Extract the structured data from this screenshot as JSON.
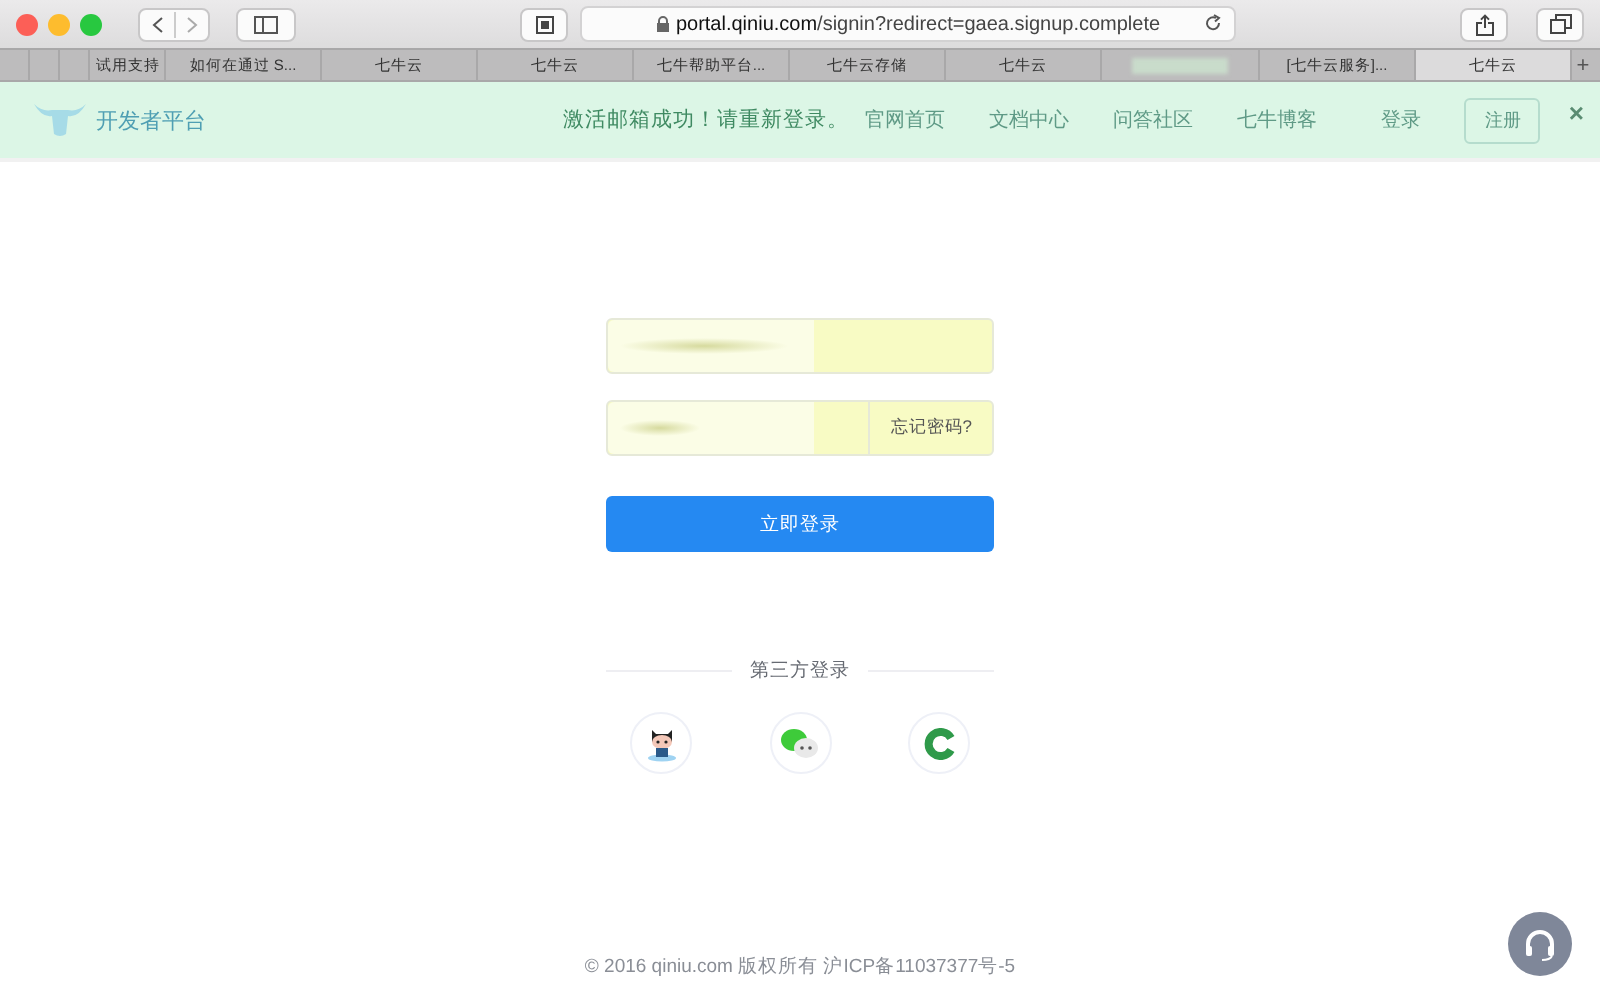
{
  "browser": {
    "url_host": "portal.qiniu.com",
    "url_path": "/signin?redirect=gaea.signup.complete"
  },
  "tabs": [
    {
      "kind": "stub",
      "selected": false
    },
    {
      "kind": "stub",
      "selected": false
    },
    {
      "kind": "stub",
      "selected": false
    },
    {
      "label": "试用支持",
      "kind": "narrow",
      "selected": false
    },
    {
      "label": "如何在通过 S...",
      "kind": "normal",
      "selected": false
    },
    {
      "label": "七牛云",
      "kind": "normal",
      "selected": false
    },
    {
      "label": "七牛云",
      "kind": "normal",
      "selected": false
    },
    {
      "label": "七牛帮助平台...",
      "kind": "normal",
      "selected": false
    },
    {
      "label": "七牛云存储",
      "kind": "normal",
      "selected": false
    },
    {
      "label": "七牛云",
      "kind": "normal",
      "selected": false
    },
    {
      "kind": "blurred",
      "selected": false
    },
    {
      "label": "[七牛云服务]...",
      "kind": "normal",
      "selected": false
    },
    {
      "label": "七牛云",
      "kind": "normal",
      "selected": true
    }
  ],
  "new_tab": "+",
  "header": {
    "brand": "开发者平台",
    "nav": [
      "官网首页",
      "文档中心",
      "问答社区",
      "七牛博客"
    ],
    "login": "登录",
    "register": "注册"
  },
  "notice": {
    "message": "激活邮箱成功！请重新登录。",
    "close": "×"
  },
  "form": {
    "forgot": "忘记密码?",
    "submit": "立即登录",
    "third_party_title": "第三方登录"
  },
  "footer": {
    "copyright": "© 2016 qiniu.com 版权所有 沪ICP备11037377号-5"
  }
}
